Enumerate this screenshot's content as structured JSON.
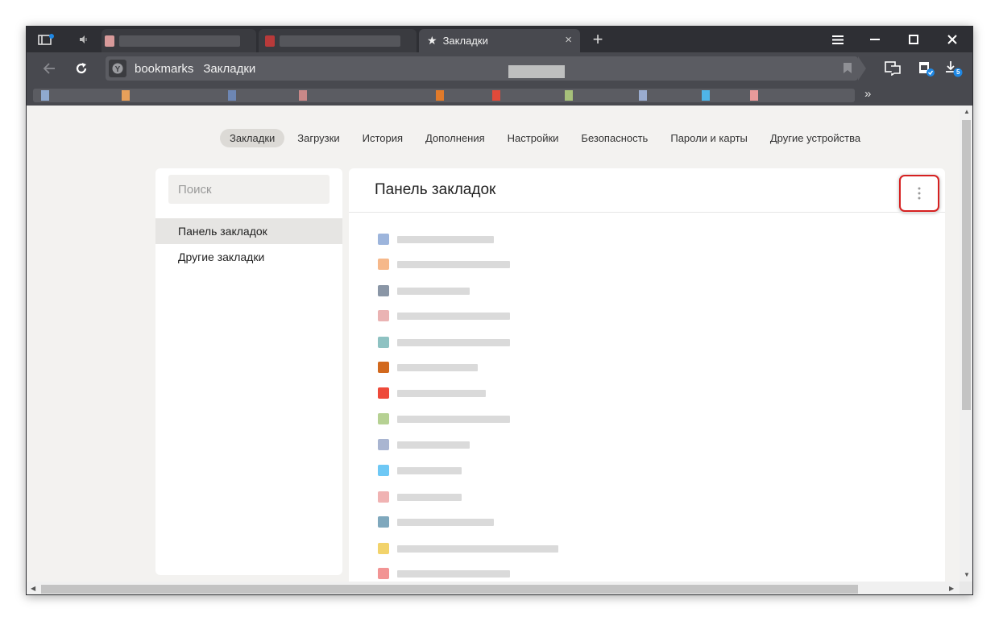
{
  "browser": {
    "active_tab_title": "Закладки",
    "new_tab_label": "+",
    "tab_close_label": "×"
  },
  "address_bar": {
    "host": "bookmarks",
    "title": "Закладки"
  },
  "toolbar": {
    "downloads_count": "5",
    "bookmarks_overflow": "»"
  },
  "nav": {
    "items": [
      {
        "label": "Закладки",
        "active": true
      },
      {
        "label": "Загрузки",
        "active": false
      },
      {
        "label": "История",
        "active": false
      },
      {
        "label": "Дополнения",
        "active": false
      },
      {
        "label": "Настройки",
        "active": false
      },
      {
        "label": "Безопасность",
        "active": false
      },
      {
        "label": "Пароли и карты",
        "active": false
      },
      {
        "label": "Другие устройства",
        "active": false
      }
    ]
  },
  "sidebar": {
    "search_placeholder": "Поиск",
    "folders": [
      {
        "label": "Панель закладок",
        "selected": true
      },
      {
        "label": "Другие закладки",
        "selected": false
      }
    ]
  },
  "main": {
    "title": "Панель закладок",
    "menu_icon": "more-vertical-icon",
    "highlight_color": "#d62020"
  },
  "colors": {
    "tabbar": "#2e2f34",
    "toolbar": "#48494f",
    "page_bg": "#f3f2f0",
    "card_bg": "#ffffff",
    "accent_badge": "#1e88e5"
  }
}
